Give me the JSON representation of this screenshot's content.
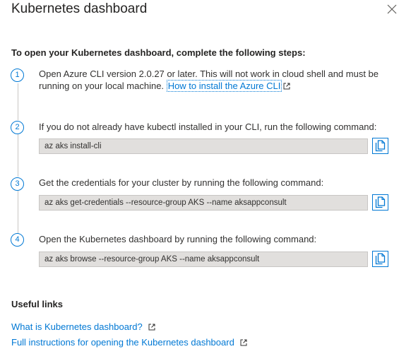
{
  "panel": {
    "title": "Kubernetes dashboard",
    "close_icon": "close-icon"
  },
  "instructions": {
    "heading": "To open your Kubernetes dashboard, complete the following steps:",
    "steps": [
      {
        "number": "1",
        "text": "Open Azure CLI version 2.0.27 or later. This will not work in cloud shell and must be running on your local machine.",
        "link_label": "How to install the Azure CLI",
        "link_icon": "external-link-icon"
      },
      {
        "number": "2",
        "text": "If you do not already have kubectl installed in your CLI, run the following command:",
        "command": "az aks install-cli",
        "copy_icon": "copy-icon"
      },
      {
        "number": "3",
        "text": "Get the credentials for your cluster by running the following command:",
        "command": "az aks get-credentials --resource-group AKS --name aksappconsult",
        "copy_icon": "copy-icon"
      },
      {
        "number": "4",
        "text": "Open the Kubernetes dashboard by running the following command:",
        "command": "az aks browse --resource-group AKS --name aksappconsult",
        "copy_icon": "copy-icon"
      }
    ]
  },
  "useful_links": {
    "heading": "Useful links",
    "links": [
      {
        "label": "What is Kubernetes dashboard?",
        "icon": "external-link-icon"
      },
      {
        "label": "Full instructions for opening the Kubernetes dashboard",
        "icon": "external-link-icon"
      }
    ]
  },
  "colors": {
    "accent": "#0078d4",
    "command_background": "#e1dfdd",
    "text": "#323130"
  }
}
